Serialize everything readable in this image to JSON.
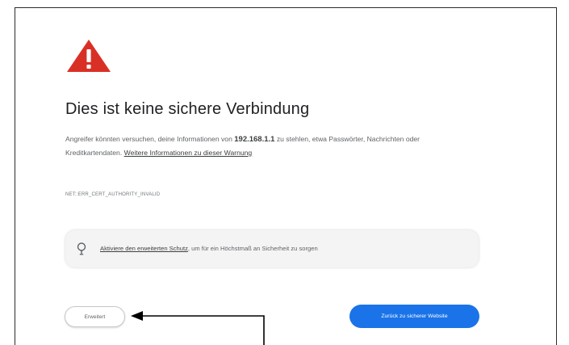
{
  "page": {
    "title": "Dies ist keine sichere Verbindung",
    "description_pre": "Angreifer könnten versuchen, deine Informationen von ",
    "host": "192.168.1.1",
    "description_post": " zu stehlen, etwa Passwörter, Nachrichten oder Kreditkartendaten. ",
    "more_info_link": "Weitere Informationen zu dieser Warnung",
    "error_code": "NET::ERR_CERT_AUTHORITY_INVALID"
  },
  "protection": {
    "link_text": "Aktiviere den erweiterten Schutz",
    "rest_text": ", um für ein Höchstmaß an Sicherheit zu sorgen"
  },
  "buttons": {
    "advanced": "Erweitert",
    "back_to_safety": "Zurück zu sicherer Website"
  },
  "colors": {
    "warning_red": "#d93025",
    "primary_blue": "#1a73e8"
  },
  "icons": {
    "warning": "warning-triangle-icon",
    "hint": "lightbulb-icon",
    "annotation": "arrow-annotation"
  }
}
